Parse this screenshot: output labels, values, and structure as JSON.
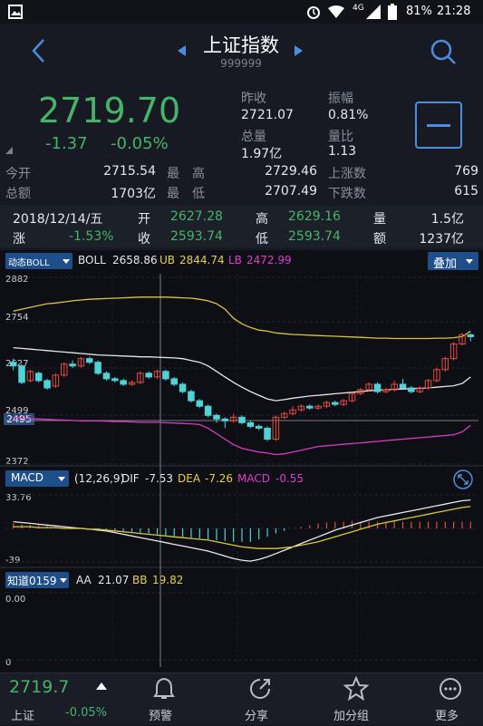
{
  "status": {
    "network": "4G",
    "battery": "81%",
    "time": "21:28"
  },
  "header": {
    "title": "上证指数",
    "code": "999999"
  },
  "quote": {
    "price": "2719.70",
    "change": "-1.37",
    "pct": "-0.05%",
    "prev_close_label": "昨收",
    "prev_close": "2721.07",
    "amplitude_label": "振幅",
    "amplitude": "0.81%",
    "total_vol_label": "总量",
    "total_vol": "1.97亿",
    "vol_ratio_label": "量比",
    "vol_ratio": "1.13",
    "open_label": "今开",
    "open": "2715.54",
    "high_label": "最　高",
    "high": "2729.46",
    "up_count_label": "上涨数",
    "up_count": "769",
    "amount_label": "总额",
    "amount": "1703亿",
    "low_label": "最　低",
    "low": "2707.49",
    "down_count_label": "下跌数",
    "down_count": "615"
  },
  "day_info": {
    "date": "2018/12/14/五",
    "open_label": "开",
    "open": "2627.28",
    "high_label": "高",
    "high": "2629.16",
    "vol_label": "量",
    "vol": "1.5亿",
    "chg_label": "涨",
    "chg": "-1.53%",
    "close_label": "收",
    "close": "2593.74",
    "low_label": "低",
    "low": "2593.74",
    "amt_label": "额",
    "amt": "1237亿"
  },
  "indicator_bar": {
    "selector": "动态BOLL",
    "name": "BOLL",
    "mid": "2658.86",
    "ub_label": "UB",
    "ub": "2844.74",
    "lb_label": "LB",
    "lb": "2472.99",
    "overlay_button": "叠加"
  },
  "macd_bar": {
    "selector": "MACD",
    "params": "(12,26,9)",
    "dif_label": "DIF",
    "dif": "-7.53",
    "dea_label": "DEA",
    "dea": "-7.26",
    "macd_label": "MACD",
    "macd": "-0.55"
  },
  "zd_bar": {
    "selector": "知道0159",
    "aa_label": "AA",
    "aa": "21.07",
    "bb_label": "BB",
    "bb": "19.82"
  },
  "price_axis": {
    "t1": "2882",
    "t2": "2754",
    "t3": "2627",
    "t4": "2499",
    "t5": "2372",
    "cross": "2495"
  },
  "macd_axis": {
    "top": "33.76",
    "bottom": "-39"
  },
  "zd_axis": {
    "top": "0.00",
    "bottom": "0"
  },
  "bottom": {
    "price": "2719.7",
    "name": "上证",
    "pct": "-0.05%",
    "alert": "预警",
    "share": "分享",
    "add": "加分组",
    "more": "更多"
  },
  "chart_data": {
    "type": "candlestick",
    "note_axis": "price",
    "ylim": [
      2372,
      2882
    ],
    "candles": [
      [
        2650,
        2640,
        2660,
        2628
      ],
      [
        2640,
        2595,
        2645,
        2590
      ],
      [
        2600,
        2625,
        2630,
        2595
      ],
      [
        2620,
        2600,
        2625,
        2595
      ],
      [
        2600,
        2580,
        2605,
        2575
      ],
      [
        2585,
        2615,
        2620,
        2580
      ],
      [
        2615,
        2645,
        2650,
        2610
      ],
      [
        2645,
        2640,
        2655,
        2635
      ],
      [
        2640,
        2660,
        2665,
        2635
      ],
      [
        2660,
        2650,
        2665,
        2645
      ],
      [
        2650,
        2620,
        2655,
        2615
      ],
      [
        2620,
        2605,
        2625,
        2600
      ],
      [
        2605,
        2600,
        2610,
        2595
      ],
      [
        2600,
        2590,
        2605,
        2585
      ],
      [
        2590,
        2595,
        2600,
        2585
      ],
      [
        2595,
        2620,
        2625,
        2590
      ],
      [
        2620,
        2610,
        2625,
        2605
      ],
      [
        2610,
        2625,
        2630,
        2605
      ],
      [
        2625,
        2605,
        2630,
        2600
      ],
      [
        2605,
        2590,
        2610,
        2585
      ],
      [
        2590,
        2570,
        2595,
        2565
      ],
      [
        2570,
        2545,
        2575,
        2540
      ],
      [
        2545,
        2530,
        2550,
        2525
      ],
      [
        2530,
        2505,
        2535,
        2500
      ],
      [
        2505,
        2495,
        2510,
        2485
      ],
      [
        2495,
        2490,
        2500,
        2470
      ],
      [
        2490,
        2500,
        2510,
        2485
      ],
      [
        2500,
        2485,
        2505,
        2480
      ],
      [
        2485,
        2475,
        2490,
        2470
      ],
      [
        2475,
        2470,
        2480,
        2465
      ],
      [
        2470,
        2440,
        2475,
        2435
      ],
      [
        2440,
        2500,
        2505,
        2435
      ],
      [
        2500,
        2510,
        2515,
        2495
      ],
      [
        2510,
        2520,
        2530,
        2505
      ],
      [
        2520,
        2530,
        2535,
        2515
      ],
      [
        2530,
        2525,
        2535,
        2520
      ],
      [
        2525,
        2530,
        2535,
        2520
      ],
      [
        2530,
        2540,
        2545,
        2525
      ],
      [
        2540,
        2535,
        2545,
        2530
      ],
      [
        2535,
        2545,
        2550,
        2530
      ],
      [
        2545,
        2565,
        2570,
        2540
      ],
      [
        2565,
        2575,
        2580,
        2560
      ],
      [
        2575,
        2590,
        2595,
        2570
      ],
      [
        2590,
        2570,
        2595,
        2565
      ],
      [
        2570,
        2575,
        2580,
        2565
      ],
      [
        2575,
        2590,
        2600,
        2570
      ],
      [
        2590,
        2580,
        2605,
        2575
      ],
      [
        2580,
        2570,
        2585,
        2565
      ],
      [
        2570,
        2580,
        2585,
        2565
      ],
      [
        2580,
        2600,
        2605,
        2575
      ],
      [
        2600,
        2630,
        2635,
        2595
      ],
      [
        2630,
        2660,
        2665,
        2625
      ],
      [
        2660,
        2700,
        2705,
        2655
      ],
      [
        2700,
        2725,
        2730,
        2695
      ],
      [
        2725,
        2720,
        2729,
        2707
      ]
    ],
    "boll_ub": [
      2790,
      2795,
      2800,
      2805,
      2810,
      2812,
      2815,
      2818,
      2820,
      2822,
      2823,
      2824,
      2825,
      2826,
      2827,
      2828,
      2828,
      2828,
      2828,
      2827,
      2826,
      2825,
      2822,
      2818,
      2810,
      2795,
      2770,
      2755,
      2745,
      2738,
      2735,
      2730,
      2728,
      2726,
      2725,
      2724,
      2723,
      2722,
      2721,
      2720,
      2719,
      2718,
      2717,
      2716,
      2716,
      2715,
      2715,
      2715,
      2715,
      2715,
      2716,
      2716,
      2717,
      2720,
      2735
    ],
    "boll_mid": [
      2690,
      2688,
      2686,
      2684,
      2682,
      2680,
      2678,
      2676,
      2674,
      2672,
      2670,
      2669,
      2668,
      2667,
      2666,
      2665,
      2665,
      2664,
      2663,
      2662,
      2660,
      2655,
      2650,
      2640,
      2625,
      2610,
      2595,
      2582,
      2570,
      2560,
      2550,
      2545,
      2548,
      2552,
      2555,
      2558,
      2560,
      2562,
      2564,
      2566,
      2568,
      2570,
      2572,
      2574,
      2575,
      2576,
      2577,
      2578,
      2579,
      2580,
      2582,
      2584,
      2586,
      2592,
      2610
    ],
    "boll_lb": [
      2500,
      2498,
      2496,
      2495,
      2494,
      2493,
      2492,
      2491,
      2490,
      2490,
      2490,
      2489,
      2488,
      2488,
      2487,
      2486,
      2486,
      2486,
      2485,
      2484,
      2483,
      2482,
      2480,
      2470,
      2455,
      2440,
      2425,
      2415,
      2410,
      2405,
      2402,
      2398,
      2400,
      2405,
      2410,
      2415,
      2420,
      2422,
      2424,
      2426,
      2428,
      2430,
      2432,
      2434,
      2436,
      2438,
      2440,
      2442,
      2444,
      2446,
      2448,
      2450,
      2452,
      2460,
      2478
    ],
    "macd_dif": [
      8,
      7,
      6,
      5,
      4,
      3,
      2,
      1,
      0,
      -1,
      -2,
      -3,
      -5,
      -7,
      -9,
      -11,
      -13,
      -15,
      -17,
      -19,
      -21,
      -23,
      -25,
      -27,
      -30,
      -33,
      -36,
      -38,
      -39,
      -37,
      -34,
      -30,
      -26,
      -22,
      -18,
      -14,
      -10,
      -6,
      -2,
      1,
      4,
      7,
      10,
      13,
      15,
      17,
      19,
      21,
      23,
      25,
      27,
      29,
      31,
      33,
      34
    ],
    "macd_dea": [
      2,
      2,
      2,
      1,
      1,
      1,
      0,
      0,
      0,
      -1,
      -1,
      -2,
      -3,
      -4,
      -5,
      -6,
      -7,
      -8,
      -9,
      -10,
      -11,
      -12,
      -13,
      -14,
      -16,
      -18,
      -20,
      -22,
      -23,
      -24,
      -24,
      -24,
      -23,
      -22,
      -20,
      -18,
      -16,
      -13,
      -10,
      -7,
      -4,
      -1,
      2,
      5,
      7,
      9,
      11,
      13,
      15,
      17,
      19,
      21,
      23,
      25,
      26
    ],
    "macd_hist": [
      6,
      5,
      4,
      4,
      3,
      2,
      2,
      1,
      0,
      0,
      -1,
      -1,
      -2,
      -3,
      -4,
      -5,
      -6,
      -7,
      -8,
      -9,
      -10,
      -11,
      -12,
      -13,
      -14,
      -15,
      -16,
      -16,
      -16,
      -13,
      -10,
      -6,
      -3,
      0,
      2,
      4,
      6,
      7,
      8,
      8,
      9,
      8,
      8,
      8,
      8,
      8,
      8,
      8,
      8,
      8,
      8,
      8,
      8,
      8,
      8
    ]
  }
}
